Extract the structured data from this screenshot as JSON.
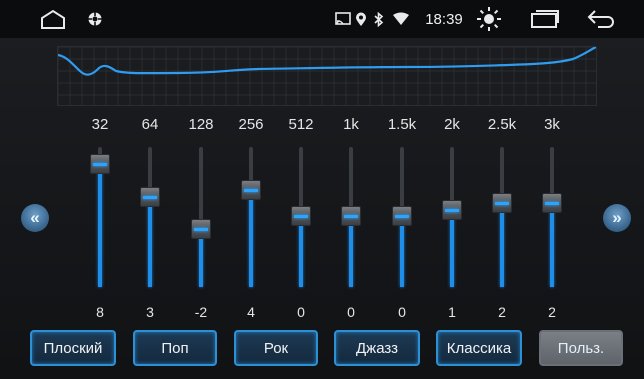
{
  "status_bar": {
    "time": "18:39",
    "icons": [
      "home-icon",
      "settings-icon",
      "cast-icon",
      "location-icon",
      "bluetooth-icon",
      "wifi-icon",
      "brightness-icon",
      "recent-apps-icon",
      "back-icon"
    ]
  },
  "equalizer": {
    "bands": [
      {
        "freq": "32",
        "gain": "8"
      },
      {
        "freq": "64",
        "gain": "3"
      },
      {
        "freq": "128",
        "gain": "-2"
      },
      {
        "freq": "256",
        "gain": "4"
      },
      {
        "freq": "512",
        "gain": "0"
      },
      {
        "freq": "1k",
        "gain": "0"
      },
      {
        "freq": "1.5k",
        "gain": "0"
      },
      {
        "freq": "2k",
        "gain": "1"
      },
      {
        "freq": "2.5k",
        "gain": "2"
      },
      {
        "freq": "3k",
        "gain": "2"
      }
    ],
    "gain_range": [
      -12,
      12
    ],
    "accent_color": "#1f8ee8"
  },
  "presets": {
    "items": [
      "Плоский",
      "Поп",
      "Рок",
      "Джазз",
      "Классика",
      "Польз."
    ],
    "selected": "Польз."
  },
  "nav": {
    "prev_icon": "double-chevron-left-icon",
    "next_icon": "double-chevron-right-icon"
  }
}
